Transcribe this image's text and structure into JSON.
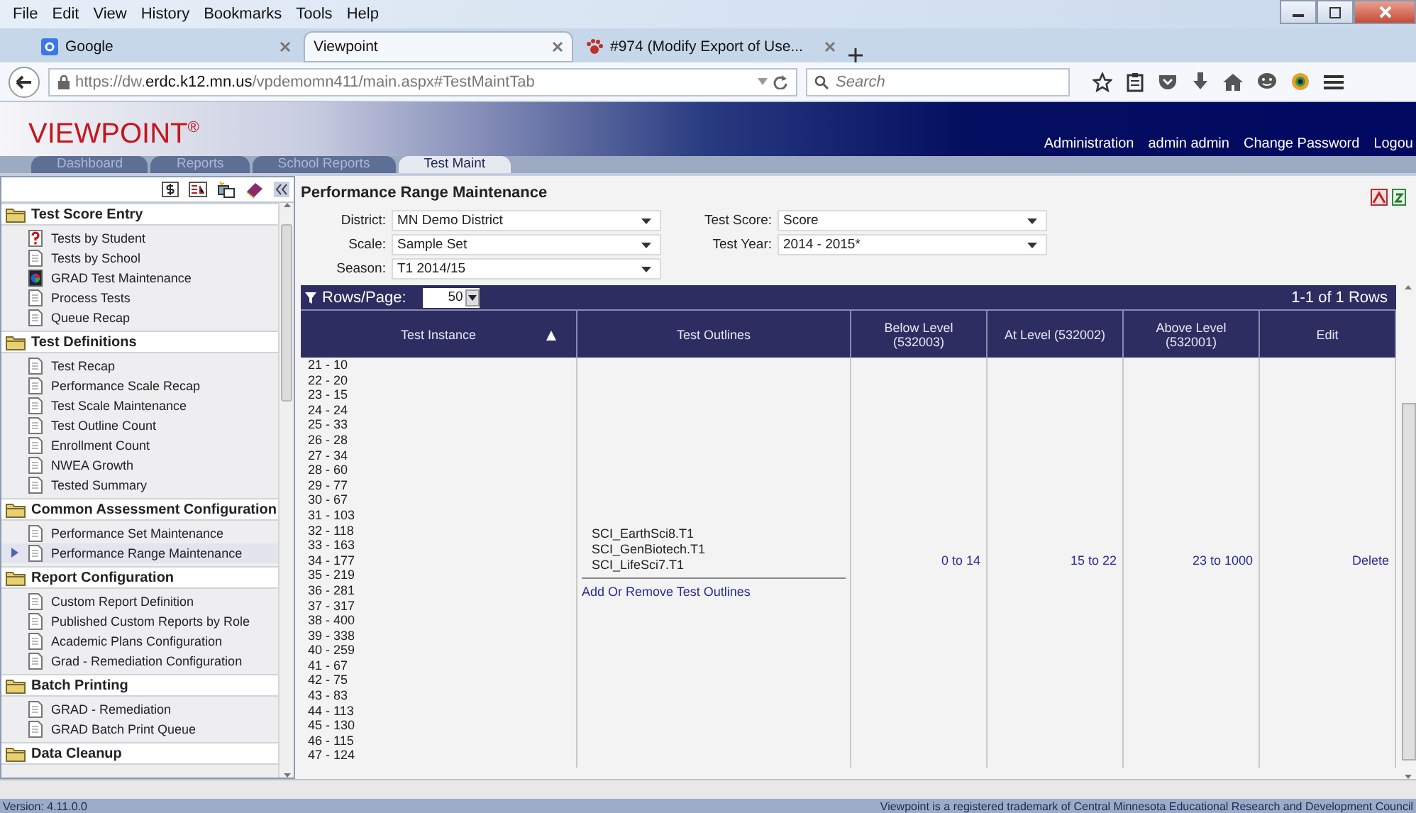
{
  "browser": {
    "menu": [
      "File",
      "Edit",
      "View",
      "History",
      "Bookmarks",
      "Tools",
      "Help"
    ],
    "tabs": [
      {
        "label": "Google",
        "kind": "google",
        "selected": false
      },
      {
        "label": "Viewpoint",
        "kind": "plain",
        "selected": true
      },
      {
        "label": "#974 (Modify Export of Use...",
        "kind": "paw",
        "selected": false
      }
    ],
    "url": "https://dw.**erdc.k12.mn.us**/vpdemomn411/main.aspx#TestMaintTab",
    "search": {
      "placeholder": "Search"
    }
  },
  "app": {
    "logo": "VIEWPOINT",
    "logo_mark": "®",
    "header_links": [
      "Administration",
      "admin admin",
      "Change Password",
      "Logou"
    ],
    "nav_tabs": [
      {
        "label": "Dashboard",
        "selected": false
      },
      {
        "label": "Reports",
        "selected": false
      },
      {
        "label": "School Reports",
        "selected": false
      },
      {
        "label": "Test Maint",
        "selected": true
      }
    ],
    "sidebar": {
      "sections": [
        {
          "title": "Test Score Entry",
          "items": [
            {
              "label": "Tests by Student",
              "kind": "question",
              "selected": false
            },
            {
              "label": "Tests by School",
              "kind": "page",
              "selected": false
            },
            {
              "label": "GRAD Test Maintenance",
              "kind": "chart",
              "selected": false
            },
            {
              "label": "Process Tests",
              "kind": "page",
              "selected": false
            },
            {
              "label": "Queue Recap",
              "kind": "page",
              "selected": false
            }
          ]
        },
        {
          "title": "Test Definitions",
          "items": [
            {
              "label": "Test Recap",
              "kind": "page",
              "selected": false
            },
            {
              "label": "Performance Scale Recap",
              "kind": "page",
              "selected": false
            },
            {
              "label": "Test Scale Maintenance",
              "kind": "page",
              "selected": false
            },
            {
              "label": "Test Outline Count",
              "kind": "page",
              "selected": false
            },
            {
              "label": "Enrollment Count",
              "kind": "page",
              "selected": false
            },
            {
              "label": "NWEA Growth",
              "kind": "page",
              "selected": false
            },
            {
              "label": "Tested Summary",
              "kind": "page",
              "selected": false
            }
          ]
        },
        {
          "title": "Common Assessment Configuration",
          "items": [
            {
              "label": "Performance Set Maintenance",
              "kind": "page",
              "selected": false
            },
            {
              "label": "Performance Range Maintenance",
              "kind": "page",
              "selected": true
            }
          ]
        },
        {
          "title": "Report Configuration",
          "items": [
            {
              "label": "Custom Report Definition",
              "kind": "page",
              "selected": false
            },
            {
              "label": "Published Custom Reports by Role",
              "kind": "page",
              "selected": false
            },
            {
              "label": "Academic Plans Configuration",
              "kind": "page",
              "selected": false
            },
            {
              "label": "Grad - Remediation Configuration",
              "kind": "page",
              "selected": false
            }
          ]
        },
        {
          "title": "Batch Printing",
          "items": [
            {
              "label": "GRAD - Remediation",
              "kind": "page",
              "selected": false
            },
            {
              "label": "GRAD Batch Print Queue",
              "kind": "page",
              "selected": false
            }
          ]
        },
        {
          "title": "Data Cleanup"
        }
      ]
    },
    "content": {
      "title": "Performance Range Maintenance",
      "filters": [
        {
          "label": "District:",
          "value": "MN Demo District"
        },
        {
          "label": "Test Score:",
          "value": "Score"
        },
        {
          "label": "Scale:",
          "value": "Sample Set"
        },
        {
          "label": "Test Year:",
          "value": "2014 - 2015*"
        },
        {
          "label": "Season:",
          "value": "T1 2014/15"
        }
      ],
      "grid": {
        "rows_per_page_label": "Rows/Page:",
        "rows_per_page": "50",
        "row_count": "1-1 of 1 Rows",
        "columns": [
          {
            "label": "Test Instance",
            "sorted": true
          },
          {
            "label": "Test Outlines",
            "sorted": false
          },
          {
            "label": "Below Level (532003)",
            "sorted": false
          },
          {
            "label": "At Level (532002)",
            "sorted": false
          },
          {
            "label": "Above Level (532001)",
            "sorted": false
          },
          {
            "label": "Edit",
            "sorted": false
          }
        ],
        "row": {
          "test_instances": [
            "21 - 10",
            "22 - 20",
            "23 - 15",
            "24 - 24",
            "25 - 33",
            "26 - 28",
            "27 - 34",
            "28 - 60",
            "29 - 77",
            "30 - 67",
            "31 - 103",
            "32 - 118",
            "33 - 163",
            "34 - 177",
            "35 - 219",
            "36 - 281",
            "37 - 317",
            "38 - 400",
            "39 - 338",
            "40 - 259",
            "41 - 67",
            "42 - 75",
            "43 - 83",
            "44 - 113",
            "45 - 130",
            "46 - 115",
            "47 - 124"
          ],
          "test_outlines": [
            "SCI_EarthSci8.T1",
            "SCI_GenBiotech.T1",
            "SCI_LifeSci7.T1"
          ],
          "outline_link": "Add Or Remove Test Outlines",
          "below": "0 to 14",
          "at": "15 to 22",
          "above": "23 to 1000",
          "edit": "Delete"
        }
      }
    },
    "footer": {
      "version": "Version: 4.11.0.0",
      "trademark": "Viewpoint is a registered trademark of Central Minnesota Educational Research and Development Council"
    }
  }
}
